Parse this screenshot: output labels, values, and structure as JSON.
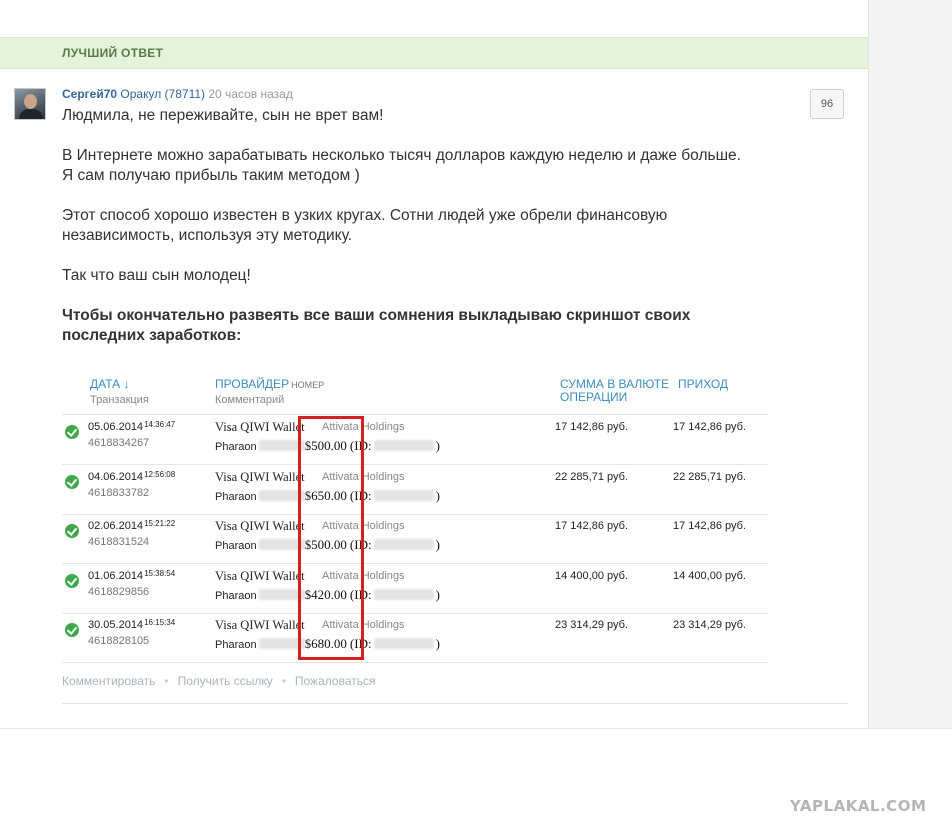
{
  "best_answer": {
    "label": "ЛУЧШИЙ ОТВЕТ"
  },
  "author": {
    "name": "Сергей70",
    "rank": "Оракул (78711)",
    "time": "20 часов назад"
  },
  "vote_count": "96",
  "answer": {
    "p1": "Людмила, не переживайте, сын не врет вам!",
    "p2": "В Интернете можно зарабатывать несколько тысяч долларов каждую неделю и даже больше.\nЯ сам получаю прибыль таким методом )",
    "p3": "Этот способ хорошо известен в узких кругах. Сотни людей уже обрели финансовую\nнезависимость, используя эту методику.",
    "p4": "Так что ваш сын молодец!",
    "p5": "Чтобы окончательно развеять все ваши сомнения выкладываю скриншот своих\nпоследних заработков:"
  },
  "table": {
    "headers": {
      "date": "ДАТА ↓",
      "date_sub": "Транзакция",
      "provider": "ПРОВАЙДЕР",
      "provider_small": "НОМЕР",
      "provider_sub": "Комментарий",
      "sum": "СУММА В ВАЛЮТЕ",
      "sum_line2": "ОПЕРАЦИИ",
      "income": "ПРИХОД"
    },
    "rows": [
      {
        "date": "05.06.2014",
        "time": "14:36:47",
        "id": "4618834267",
        "provider": "Visa QIWI Wallet",
        "company": "Attivata Holdings",
        "comment_prefix": "Pharaon",
        "amount_usd": "$500.00",
        "id_label": "(ID:",
        "id_close": ")",
        "sum": "17 142,86 руб.",
        "income": "17 142,86 руб."
      },
      {
        "date": "04.06.2014",
        "time": "12:56:08",
        "id": "4618833782",
        "provider": "Visa QIWI Wallet",
        "company": "Attivata Holdings",
        "comment_prefix": "Pharaon",
        "amount_usd": "$650.00",
        "id_label": "(ID:",
        "id_close": ")",
        "sum": "22 285,71 руб.",
        "income": "22 285,71 руб."
      },
      {
        "date": "02.06.2014",
        "time": "15:21:22",
        "id": "4618831524",
        "provider": "Visa QIWI Wallet",
        "company": "Attivata Holdings",
        "comment_prefix": "Pharaon",
        "amount_usd": "$500.00",
        "id_label": "(ID:",
        "id_close": ")",
        "sum": "17 142,86 руб.",
        "income": "17 142,86 руб."
      },
      {
        "date": "01.06.2014",
        "time": "15:38:54",
        "id": "4618829856",
        "provider": "Visa QIWI Wallet",
        "company": "Attivata Holdings",
        "comment_prefix": "Pharaon",
        "amount_usd": "$420.00",
        "id_label": "(ID:",
        "id_close": ")",
        "sum": "14 400,00 руб.",
        "income": "14 400,00 руб."
      },
      {
        "date": "30.05.2014",
        "time": "16:15:34",
        "id": "4618828105",
        "provider": "Visa QIWI Wallet",
        "company": "Attivata Holdings",
        "comment_prefix": "Pharaon",
        "amount_usd": "$680.00",
        "id_label": "(ID:",
        "id_close": ")",
        "sum": "23 314,29 руб.",
        "income": "23 314,29 руб."
      }
    ]
  },
  "actions": {
    "comment": "Комментировать",
    "get_link": "Получить ссылку",
    "report": "Пожаловаться",
    "separator": "•"
  },
  "watermark": "YAPLAKAL.COM",
  "colors": {
    "accent_link": "#336699",
    "best_bar_bg": "#e6f3dc",
    "check_green": "#3fa84b",
    "highlight_red": "#d42020",
    "table_header_blue": "#3d8ec0"
  }
}
